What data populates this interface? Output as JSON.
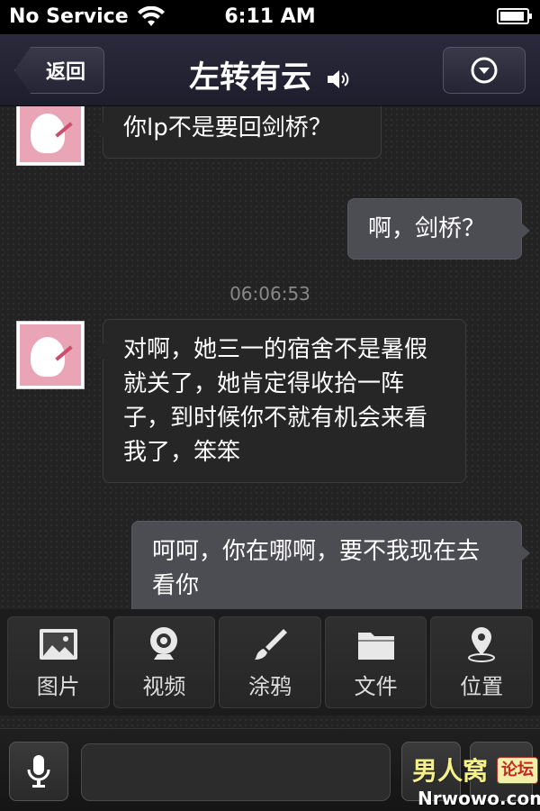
{
  "status_bar": {
    "carrier": "No Service",
    "time": "6:11 AM"
  },
  "nav": {
    "back_label": "返回",
    "title": "左转有云"
  },
  "chat": {
    "messages": [
      {
        "side": "left",
        "text": "你lp不是要回剑桥？"
      },
      {
        "side": "right",
        "text": "啊，剑桥？"
      },
      {
        "side": "left",
        "text": "对啊，她三一的宿舍不是暑假就关了，她肯定得收拾一阵子，到时候你不就有机会来看我了，笨笨"
      },
      {
        "side": "right",
        "text": "呵呵，你在哪啊，要不我现在去看你"
      }
    ],
    "timestamp": "06:06:53"
  },
  "actions": [
    {
      "label": "图片",
      "icon": "image-icon"
    },
    {
      "label": "视频",
      "icon": "webcam-icon"
    },
    {
      "label": "涂鸦",
      "icon": "brush-icon"
    },
    {
      "label": "文件",
      "icon": "folder-icon"
    },
    {
      "label": "位置",
      "icon": "location-pin-icon"
    }
  ],
  "input": {
    "value": "",
    "placeholder": ""
  },
  "watermark": {
    "main": "男人窝",
    "tag": "论坛",
    "domain": "Nrwowo.com"
  },
  "colors": {
    "bubble_left": "#262626",
    "bubble_right": "#4c4c53",
    "nav_bg": "#2b2a3c"
  }
}
